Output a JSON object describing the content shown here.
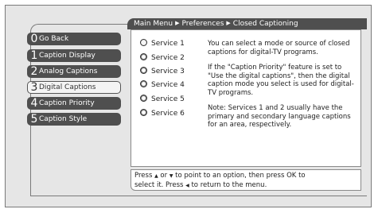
{
  "breadcrumb": {
    "items": [
      "Main Menu",
      "Preferences",
      "Closed Captioning"
    ],
    "separator": "▶"
  },
  "menu": {
    "items": [
      {
        "num": "0",
        "label": "Go Back",
        "selected": false
      },
      {
        "num": "1",
        "label": "Caption Display",
        "selected": false
      },
      {
        "num": "2",
        "label": "Analog Captions",
        "selected": false
      },
      {
        "num": "3",
        "label": "Digital Captions",
        "selected": true
      },
      {
        "num": "4",
        "label": "Caption Priority",
        "selected": false
      },
      {
        "num": "5",
        "label": "Caption Style",
        "selected": false
      }
    ]
  },
  "services": {
    "items": [
      {
        "label": "Service 1",
        "selected": true
      },
      {
        "label": "Service 2",
        "selected": false
      },
      {
        "label": "Service 3",
        "selected": false
      },
      {
        "label": "Service 4",
        "selected": false
      },
      {
        "label": "Service 5",
        "selected": false
      },
      {
        "label": "Service 6",
        "selected": false
      }
    ]
  },
  "description": {
    "p1": "You can select a mode or source of closed captions for digital-TV programs.",
    "p2": "If the \"Caption Priority\" feature is set to \"Use the digital captions\", then the digital caption mode you select is used for digital-TV programs.",
    "p3": "Note: Services 1 and 2 usually have the primary and secondary language captions for an area, respectively."
  },
  "instructions": {
    "line1_a": "Press",
    "up_arrow": "▲",
    "line1_b": "or",
    "down_arrow": "▼",
    "line1_c": "to point to an option, then press OK to",
    "line2_a": "select it. Press",
    "left_arrow": "◀",
    "line2_b": "to return to the menu."
  },
  "colors": {
    "menu_bg": "#4f4f4f",
    "header_bg": "#4f4f4f",
    "screen_bg": "#e6e6e6",
    "panel_bg": "#ffffff"
  }
}
